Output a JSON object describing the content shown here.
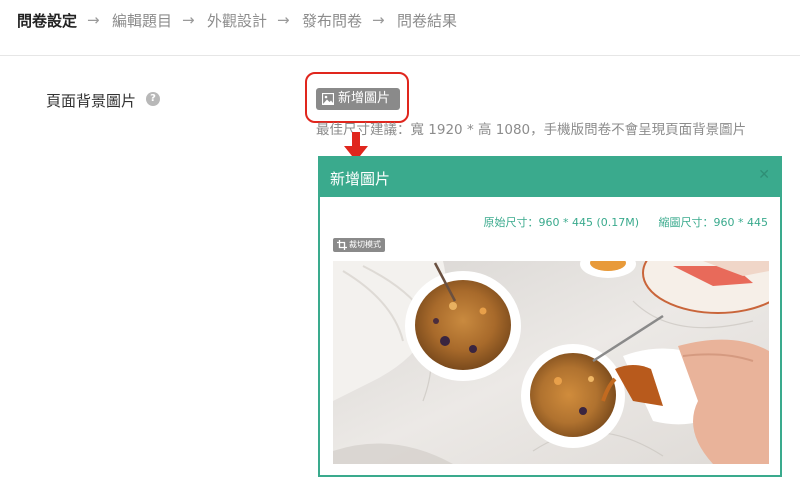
{
  "steps": [
    {
      "label": "問卷設定"
    },
    {
      "label": "編輯題目"
    },
    {
      "label": "外觀設計"
    },
    {
      "label": "發布問卷"
    },
    {
      "label": "問卷結果"
    }
  ],
  "step_arrow": "→",
  "field": {
    "label": "頁面背景圖片",
    "help": "?"
  },
  "add_button": {
    "label": "新增圖片"
  },
  "hint": "最佳尺寸建議：寬 1920 * 高 1080，手機版問卷不會呈現頁面背景圖片",
  "modal": {
    "title": "新增圖片",
    "close": "✕",
    "original_size": "原始尺寸：960 * 445 (0.17M)",
    "scaled_size": "縮圖尺寸：960 * 445",
    "crop_label": "裁切模式"
  },
  "colors": {
    "accent": "#3aaa8d",
    "highlight": "#e0261d",
    "button_gray": "#8a8a8a"
  }
}
